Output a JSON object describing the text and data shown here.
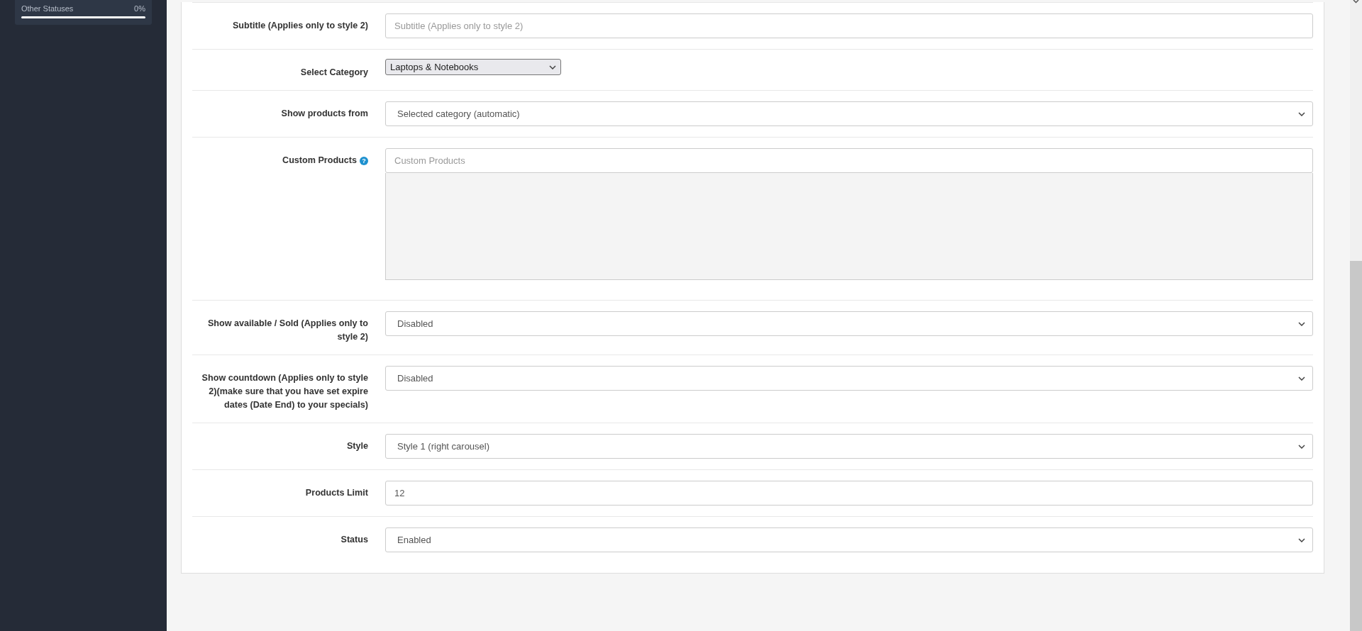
{
  "sidebar": {
    "stat": {
      "label": "Other Statuses",
      "reading": "0%",
      "level": 0
    }
  },
  "form": {
    "fields": [
      {
        "kind": "text",
        "label": "Subtitle (Applies only to style 2)",
        "placeholder": "Subtitle (Applies only to style 2)"
      },
      {
        "kind": "compact-select",
        "label": "Select Category",
        "value": "Laptops & Notebooks"
      },
      {
        "kind": "select",
        "label": "Show products from",
        "value": "Selected category (automatic)"
      },
      {
        "kind": "autocomplete",
        "label": "Custom Products",
        "help": "?",
        "placeholder": "Custom Products"
      },
      {
        "kind": "select",
        "label": "Show available / Sold (Applies only to style 2)",
        "value": "Disabled"
      },
      {
        "kind": "select",
        "label": "Show countdown (Applies only to style 2)(make sure that you have set expire dates (Date End) to your specials)",
        "value": "Disabled"
      },
      {
        "kind": "select",
        "label": "Style",
        "value": "Style 1 (right carousel)"
      },
      {
        "kind": "text",
        "label": "Products Limit",
        "value": "12"
      },
      {
        "kind": "select",
        "label": "Status",
        "value": "Enabled"
      }
    ]
  }
}
